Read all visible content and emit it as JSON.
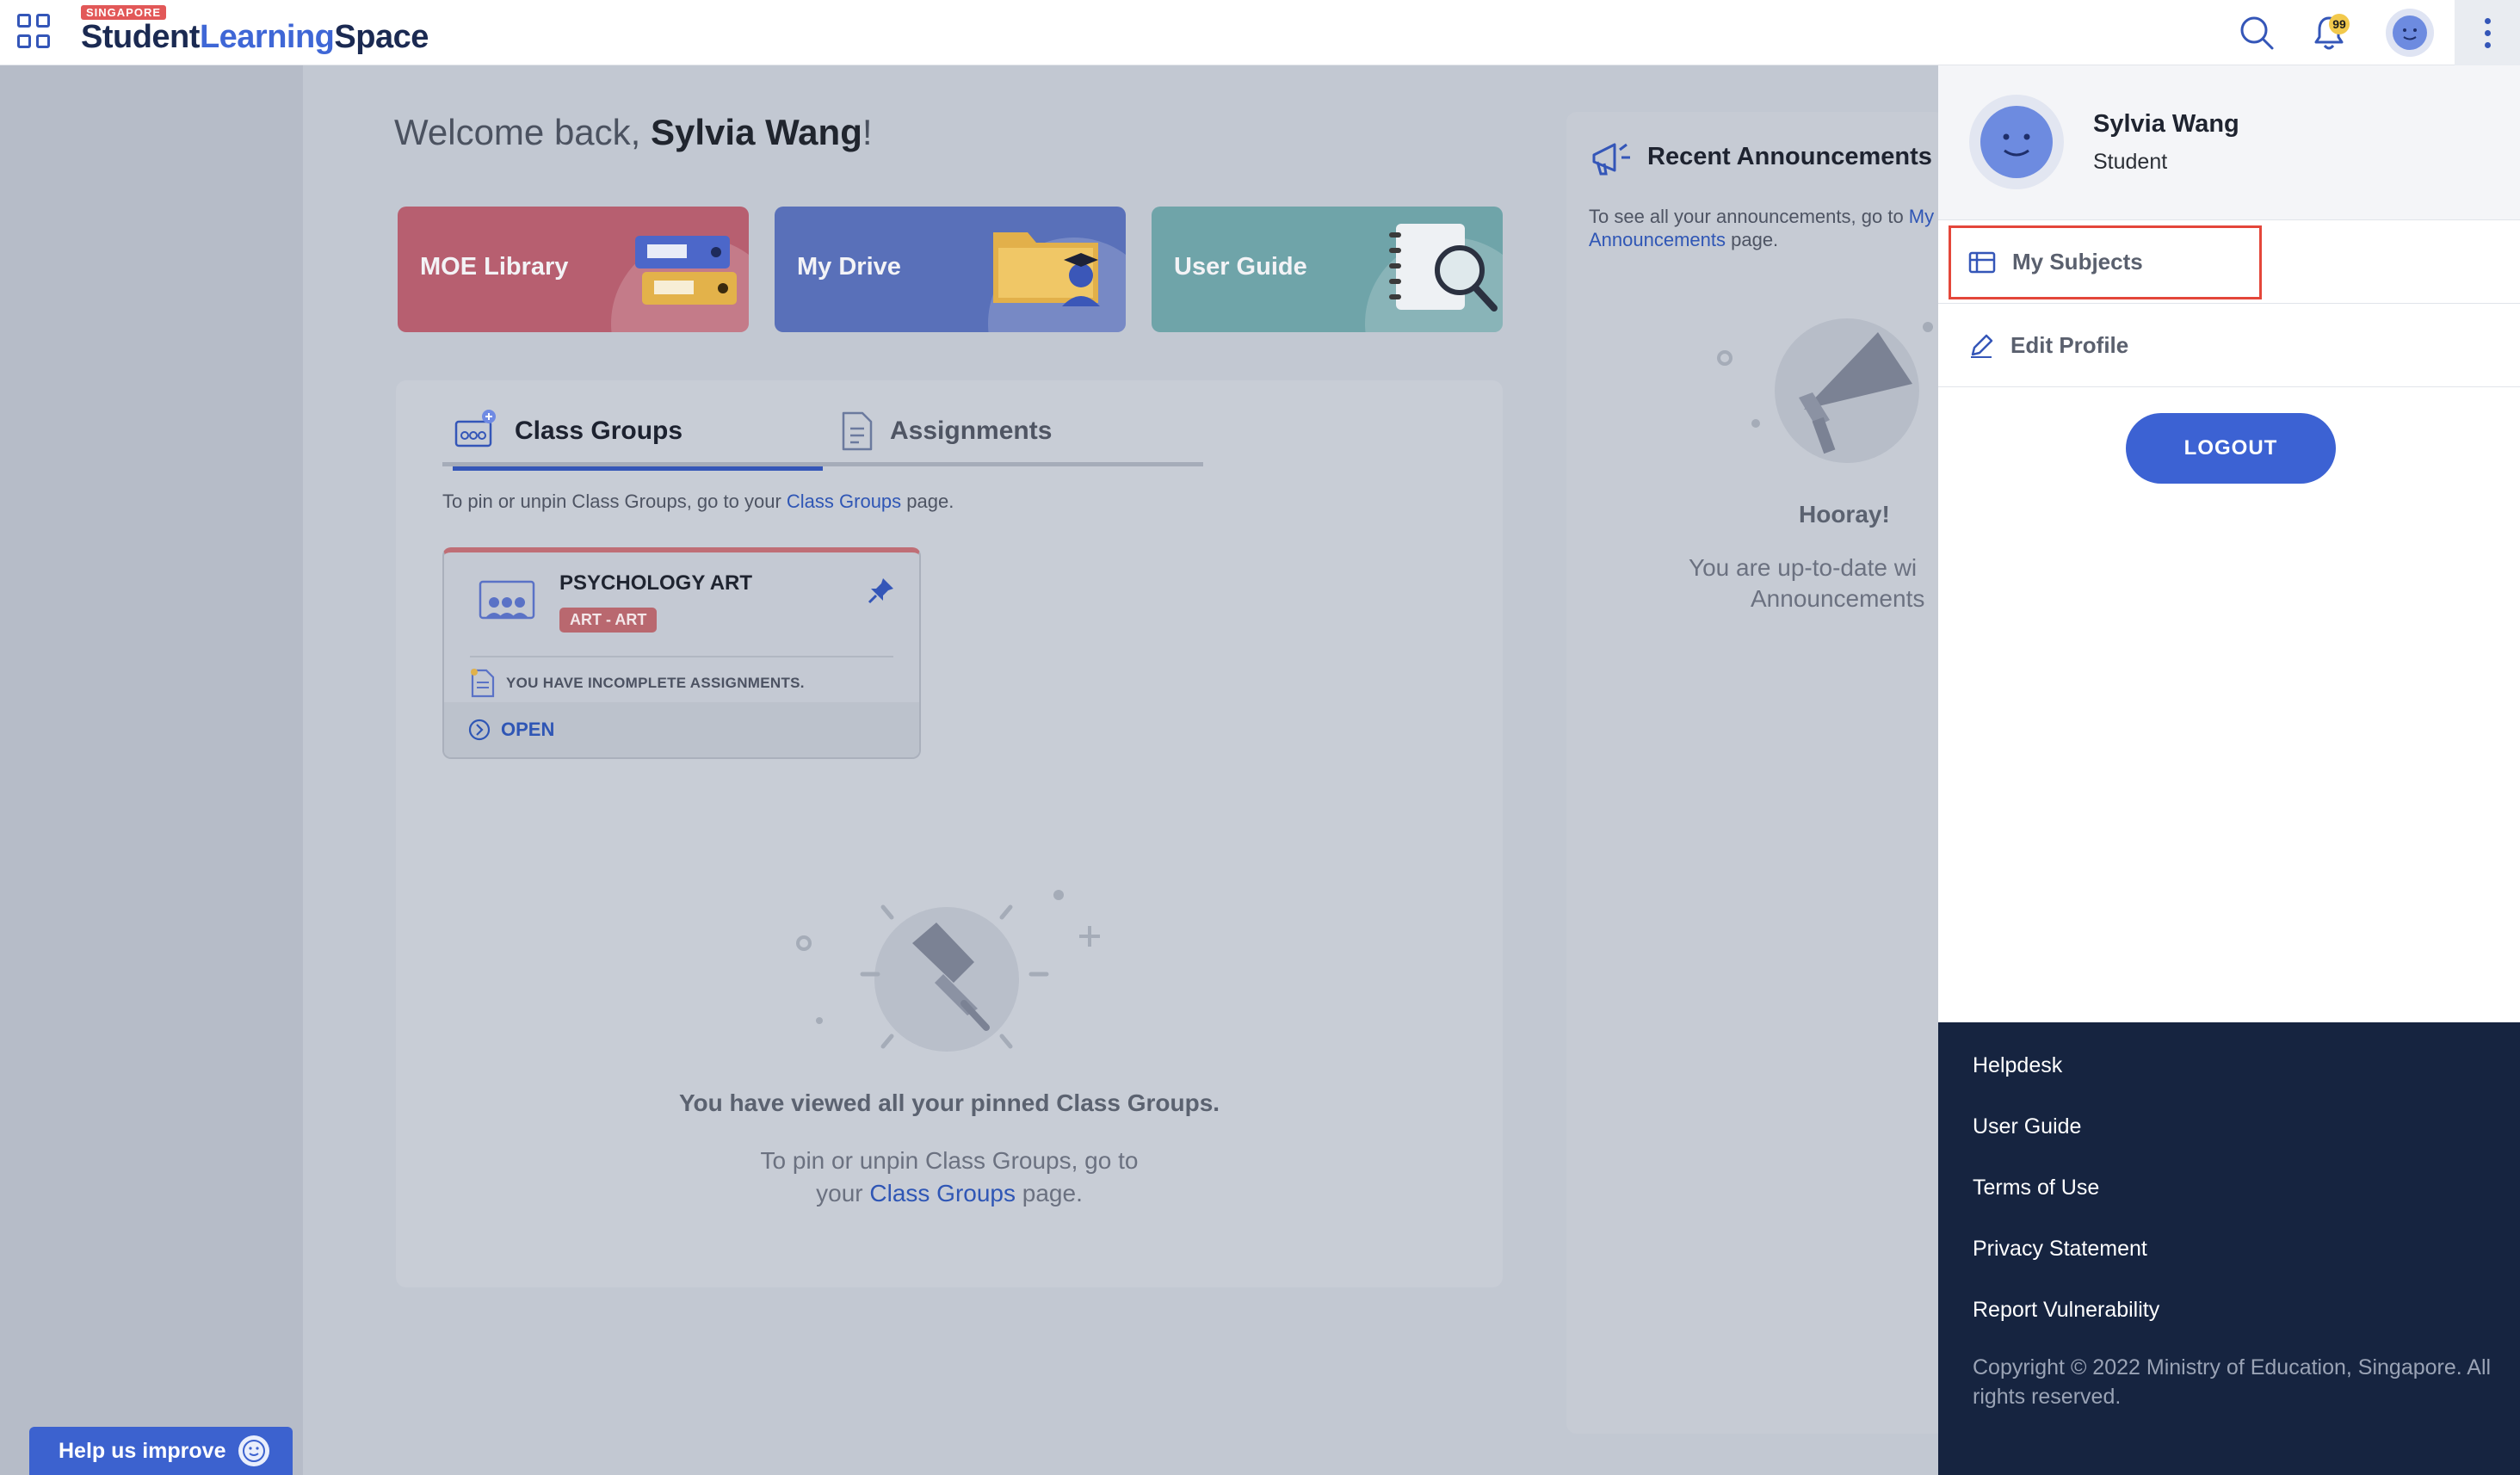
{
  "header": {
    "logo_tag": "SINGAPORE",
    "logo_word1": "Student",
    "logo_word2": "Learning",
    "logo_word3": "Space",
    "notification_count": "99"
  },
  "welcome": {
    "prefix": "Welcome back, ",
    "name": "Sylvia Wang",
    "suffix": "!"
  },
  "tiles": [
    {
      "label": "MOE Library"
    },
    {
      "label": "My Drive"
    },
    {
      "label": "User Guide"
    }
  ],
  "tabs": [
    {
      "label": "Class Groups",
      "active": true
    },
    {
      "label": "Assignments",
      "active": false
    }
  ],
  "class_groups": {
    "hint_before": "To pin or unpin Class Groups, go to your ",
    "hint_link": "Class Groups",
    "hint_after": " page.",
    "card": {
      "name": "PSYCHOLOGY ART",
      "tag": "ART - ART",
      "warning": "YOU HAVE INCOMPLETE ASSIGNMENTS.",
      "open_label": "OPEN"
    },
    "empty_title": "You have viewed all your pinned Class Groups.",
    "empty_sub_before": "To pin or unpin Class Groups, go to your ",
    "empty_sub_link": "Class Groups",
    "empty_sub_after": " page."
  },
  "announcements": {
    "title": "Recent Announcements",
    "text_before": "To see all your announcements, go to ",
    "text_link": "My Announcements",
    "text_after": " page.",
    "hooray": "Hooray!",
    "sub_line1": "You are up-to-date wi",
    "sub_line2": "Announcements"
  },
  "help": {
    "label": "Help us improve"
  },
  "drawer": {
    "user_name": "Sylvia Wang",
    "user_role": "Student",
    "items": [
      {
        "label": "My Subjects"
      },
      {
        "label": "Edit Profile"
      }
    ],
    "logout_label": "LOGOUT",
    "footer_links": [
      "Helpdesk",
      "User Guide",
      "Terms of Use",
      "Privacy Statement",
      "Report Vulnerability"
    ],
    "copyright": "Copyright © 2022 Ministry of Education, Singapore. All rights reserved."
  },
  "colors": {
    "accent": "#3c62d3",
    "drawer_footer": "#162440",
    "highlight": "#e4463a",
    "overlay": "#c2c8d2"
  }
}
